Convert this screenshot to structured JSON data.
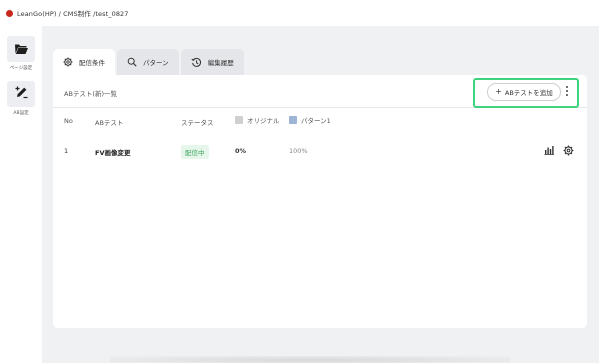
{
  "breadcrumb": "LeanGo(HP) / CMS制作 /test_0827",
  "sidebar": {
    "items": [
      {
        "label": "ページ設定",
        "icon": "folder-open-icon"
      },
      {
        "label": "AB設定",
        "icon": "edit-pencil-icon"
      }
    ]
  },
  "tabs": [
    {
      "label": "配信条件",
      "icon": "gear-icon",
      "active": true
    },
    {
      "label": "パターン",
      "icon": "search-icon",
      "active": false
    },
    {
      "label": "編集履歴",
      "icon": "history-icon",
      "active": false
    }
  ],
  "card": {
    "title": "ABテスト(新)一覧",
    "add_button_label": "ABテストを追加",
    "highlight_color": "#3fd37f"
  },
  "table": {
    "headers": {
      "no": "No",
      "abtest": "ABテスト",
      "status": "ステータス",
      "original": "オリジナル",
      "pattern": "パターン1"
    },
    "legend_colors": {
      "original": "#d0d0d0",
      "pattern": "#9fb3d6"
    },
    "rows": [
      {
        "no": "1",
        "name": "FV画像変更",
        "status": "配信中",
        "original_pct": "0%",
        "pattern_pct": "100%"
      }
    ]
  },
  "colors": {
    "status_active_bg": "#e6f6ea",
    "status_active_text": "#3aa35b"
  }
}
